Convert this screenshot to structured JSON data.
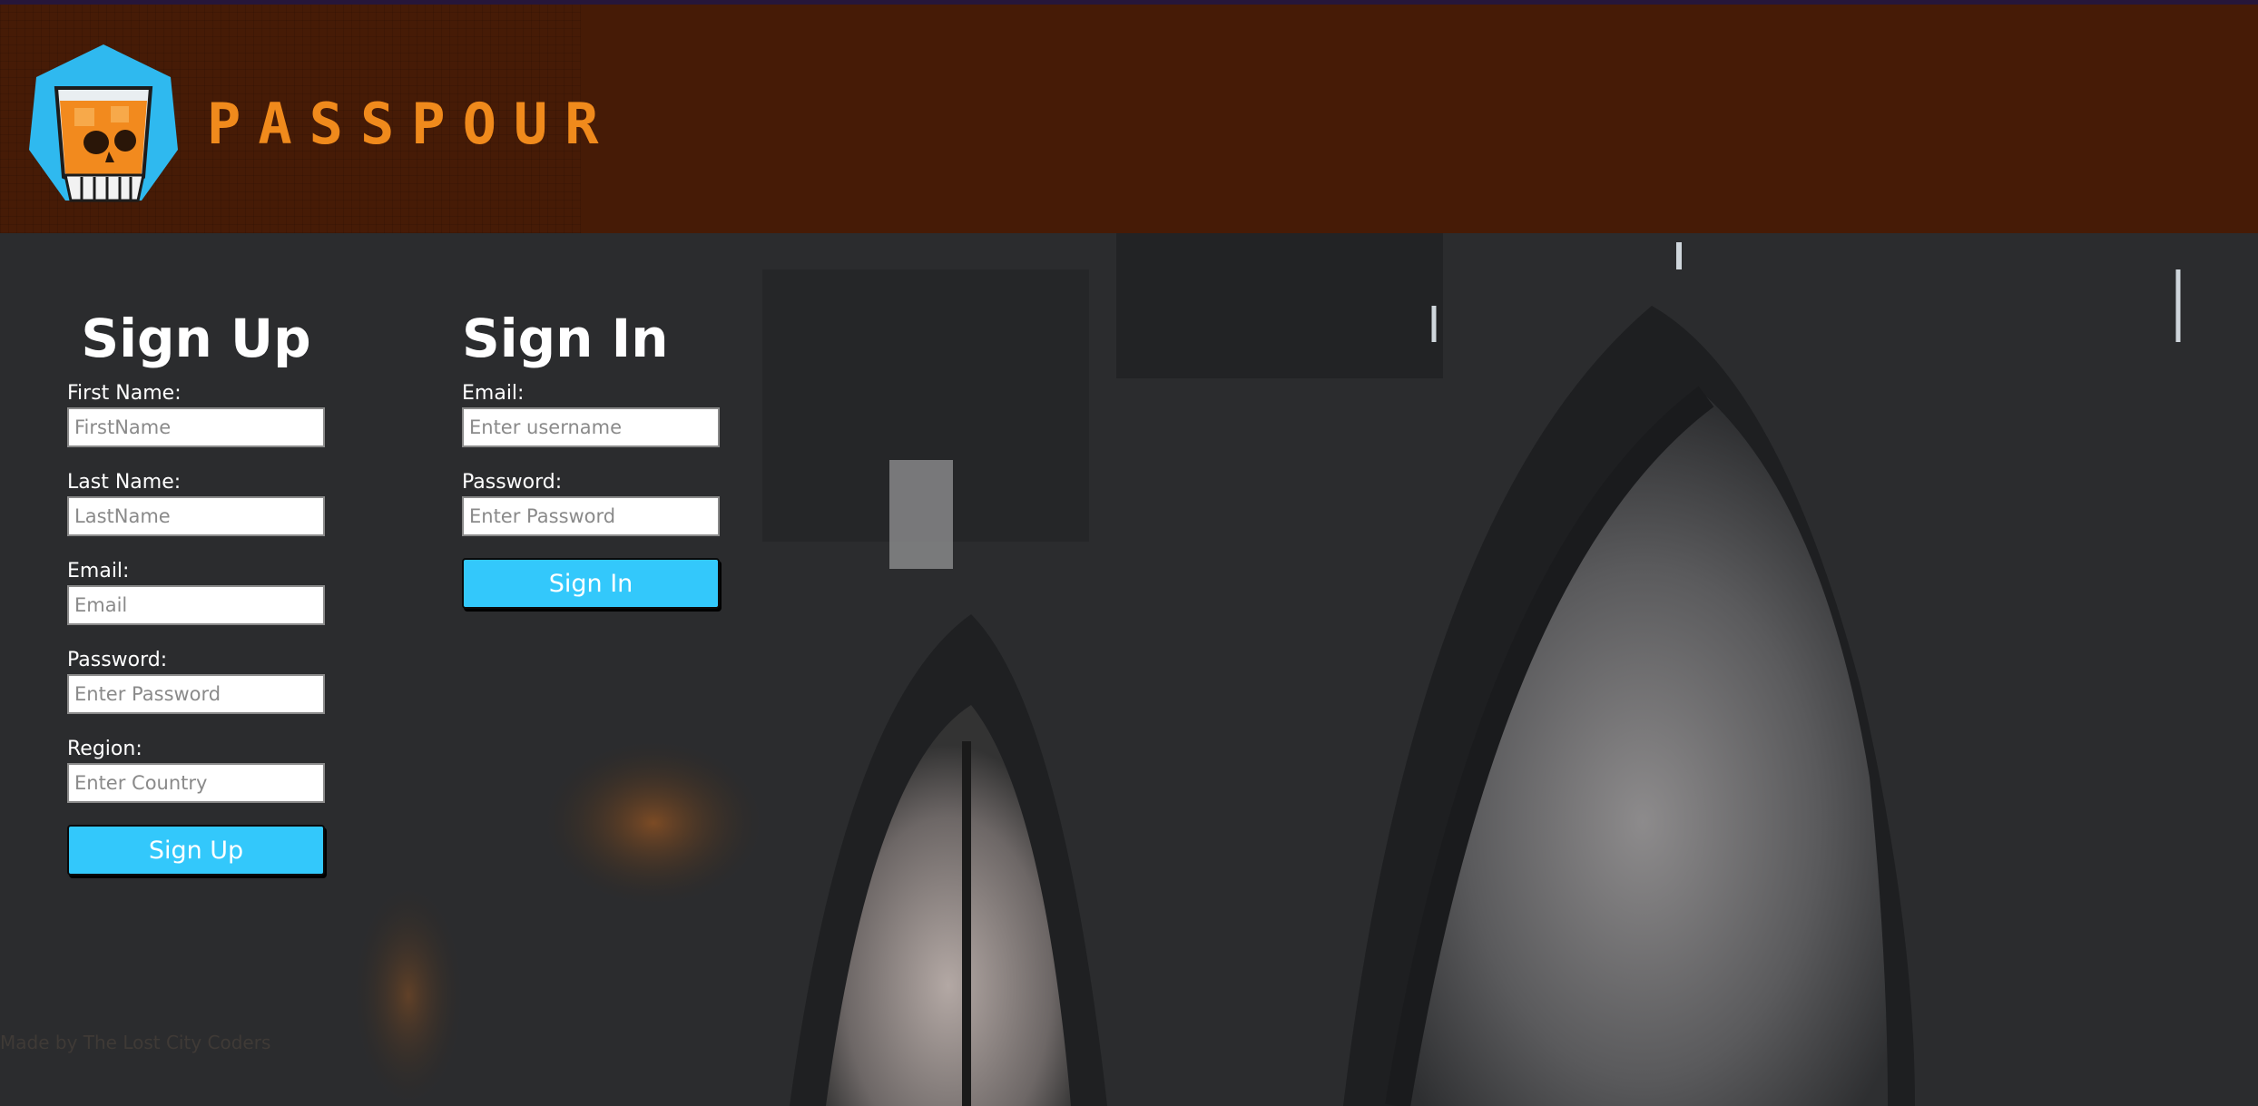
{
  "brand": {
    "name": "PASSPOUR"
  },
  "signup": {
    "title": "Sign Up",
    "fields": [
      {
        "label": "First Name:",
        "placeholder": "FirstName"
      },
      {
        "label": "Last Name:",
        "placeholder": "LastName"
      },
      {
        "label": "Email:",
        "placeholder": "Email"
      },
      {
        "label": "Password:",
        "placeholder": "Enter Password"
      },
      {
        "label": "Region:",
        "placeholder": "Enter Country"
      }
    ],
    "button_label": "Sign Up"
  },
  "signin": {
    "title": "Sign In",
    "fields": [
      {
        "label": "Email:",
        "placeholder": "Enter username"
      },
      {
        "label": "Password:",
        "placeholder": "Enter Password"
      }
    ],
    "button_label": "Sign In"
  },
  "footer": {
    "text": "Made by The Lost City Coders"
  },
  "colors": {
    "header": "#461b06",
    "brand_text": "#f08a1c",
    "button": "#33c8fb",
    "logo_bg": "#2fb9ef"
  },
  "icons": {
    "logo": "whiskey-skull-logo-icon"
  }
}
